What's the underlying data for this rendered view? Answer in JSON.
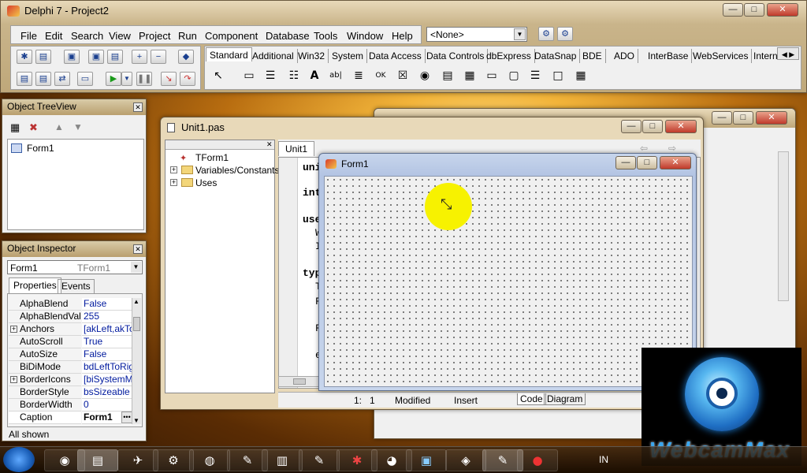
{
  "ide": {
    "title": "Delphi 7 - Project2",
    "menu": [
      "File",
      "Edit",
      "Search",
      "View",
      "Project",
      "Run",
      "Component",
      "Database",
      "Tools",
      "Window",
      "Help"
    ],
    "none_combo": "<None>",
    "palette_tabs": [
      "Standard",
      "Additional",
      "Win32",
      "System",
      "Data Access",
      "Data Controls",
      "dbExpress",
      "DataSnap",
      "BDE",
      "ADO",
      "InterBase",
      "WebServices",
      "Intern"
    ]
  },
  "tree_view": {
    "title": "Object TreeView",
    "root": "Form1"
  },
  "inspector": {
    "title": "Object Inspector",
    "object_name": "Form1",
    "object_type": "TForm1",
    "tabs": [
      "Properties",
      "Events"
    ],
    "rows": [
      {
        "name": "AlphaBlend",
        "value": "False"
      },
      {
        "name": "AlphaBlendValu",
        "value": "255"
      },
      {
        "name": "Anchors",
        "value": "[akLeft,akTo"
      },
      {
        "name": "AutoScroll",
        "value": "True"
      },
      {
        "name": "AutoSize",
        "value": "False"
      },
      {
        "name": "BiDiMode",
        "value": "bdLeftToRigh"
      },
      {
        "name": "BorderIcons",
        "value": "[biSystemMer"
      },
      {
        "name": "BorderStyle",
        "value": "bsSizeable"
      },
      {
        "name": "BorderWidth",
        "value": "0"
      },
      {
        "name": "Caption",
        "value": "Form1"
      }
    ],
    "status": "All shown"
  },
  "editor": {
    "title": "Unit1.pas",
    "tab": "Unit1",
    "explorer": [
      "TForm1",
      "Variables/Constants",
      "Uses"
    ],
    "code_fragments": [
      "uni",
      "int",
      "use",
      "W",
      "I",
      "typ",
      "T",
      "F",
      "F",
      "e"
    ],
    "status": {
      "position": "1:   1",
      "modified": "Modified",
      "mode": "Insert",
      "code_tab": "Code",
      "diagram_tab": "Diagram"
    }
  },
  "form": {
    "title": "Form1"
  },
  "overlay": {
    "brand": "WebcamMax"
  },
  "taskbar": {
    "lang": "IN"
  },
  "colors": {
    "form_title": "#c7d5ec",
    "accent_yellow": "#f7f200",
    "overlay_bg": "#000000",
    "overlay_blue": "#2a8be0"
  }
}
